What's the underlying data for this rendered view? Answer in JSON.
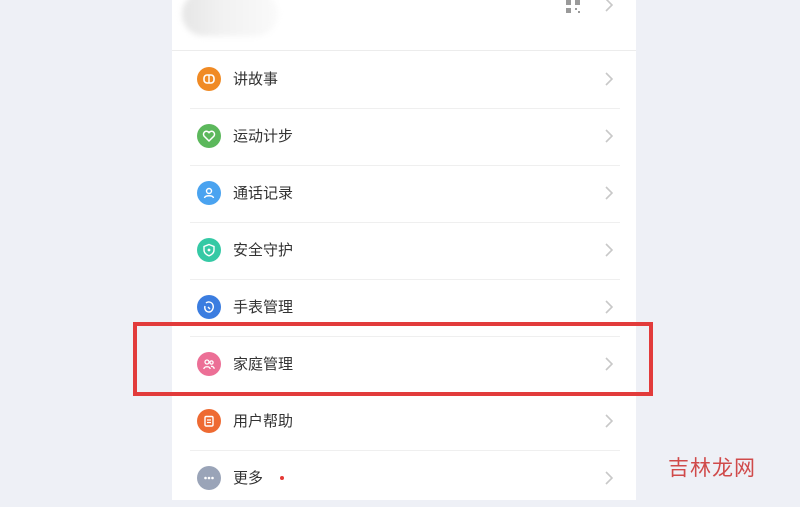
{
  "menu": {
    "items": [
      {
        "label": "讲故事",
        "icon": "story-icon",
        "color": "#f08a24"
      },
      {
        "label": "运动计步",
        "icon": "heart-icon",
        "color": "#5cb85c"
      },
      {
        "label": "通话记录",
        "icon": "contact-icon",
        "color": "#4aa3f0"
      },
      {
        "label": "安全守护",
        "icon": "shield-icon",
        "color": "#35c9a5"
      },
      {
        "label": "手表管理",
        "icon": "watch-icon",
        "color": "#3b7de0"
      },
      {
        "label": "家庭管理",
        "icon": "family-icon",
        "color": "#ec6f96"
      },
      {
        "label": "用户帮助",
        "icon": "help-icon",
        "color": "#ee6a32"
      },
      {
        "label": "更多",
        "icon": "more-icon",
        "color": "#9aa4b8",
        "has_badge": true
      }
    ]
  },
  "highlight": {
    "target": "家庭管理",
    "color": "#e23b3b"
  },
  "watermark": {
    "text": "吉林龙网"
  }
}
